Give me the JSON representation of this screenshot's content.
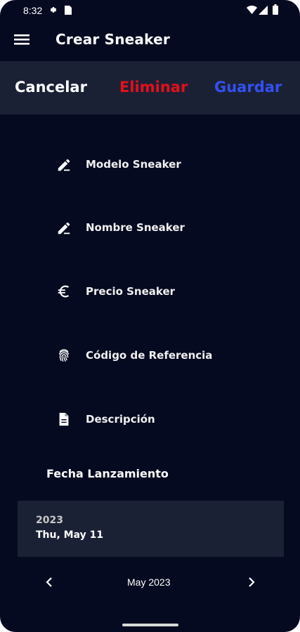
{
  "status": {
    "time": "8:32"
  },
  "app": {
    "title": "Crear Sneaker"
  },
  "actions": {
    "cancel": "Cancelar",
    "delete": "Eliminar",
    "save": "Guardar"
  },
  "colors": {
    "background": "#060a20",
    "panel": "#1b2135",
    "delete": "#e3101b",
    "save": "#3350f0",
    "text": "#ffffff"
  },
  "fields": [
    {
      "icon": "edit-pen-icon",
      "label": "Modelo Sneaker"
    },
    {
      "icon": "edit-pen-icon",
      "label": "Nombre Sneaker"
    },
    {
      "icon": "euro-icon",
      "label": "Precio Sneaker"
    },
    {
      "icon": "fingerprint-icon",
      "label": "Código de Referencia"
    },
    {
      "icon": "document-icon",
      "label": "Descripción"
    }
  ],
  "release": {
    "label": "Fecha Lanzamiento",
    "year": "2023",
    "selected_date": "Thu, May 11",
    "month_label": "May 2023"
  }
}
